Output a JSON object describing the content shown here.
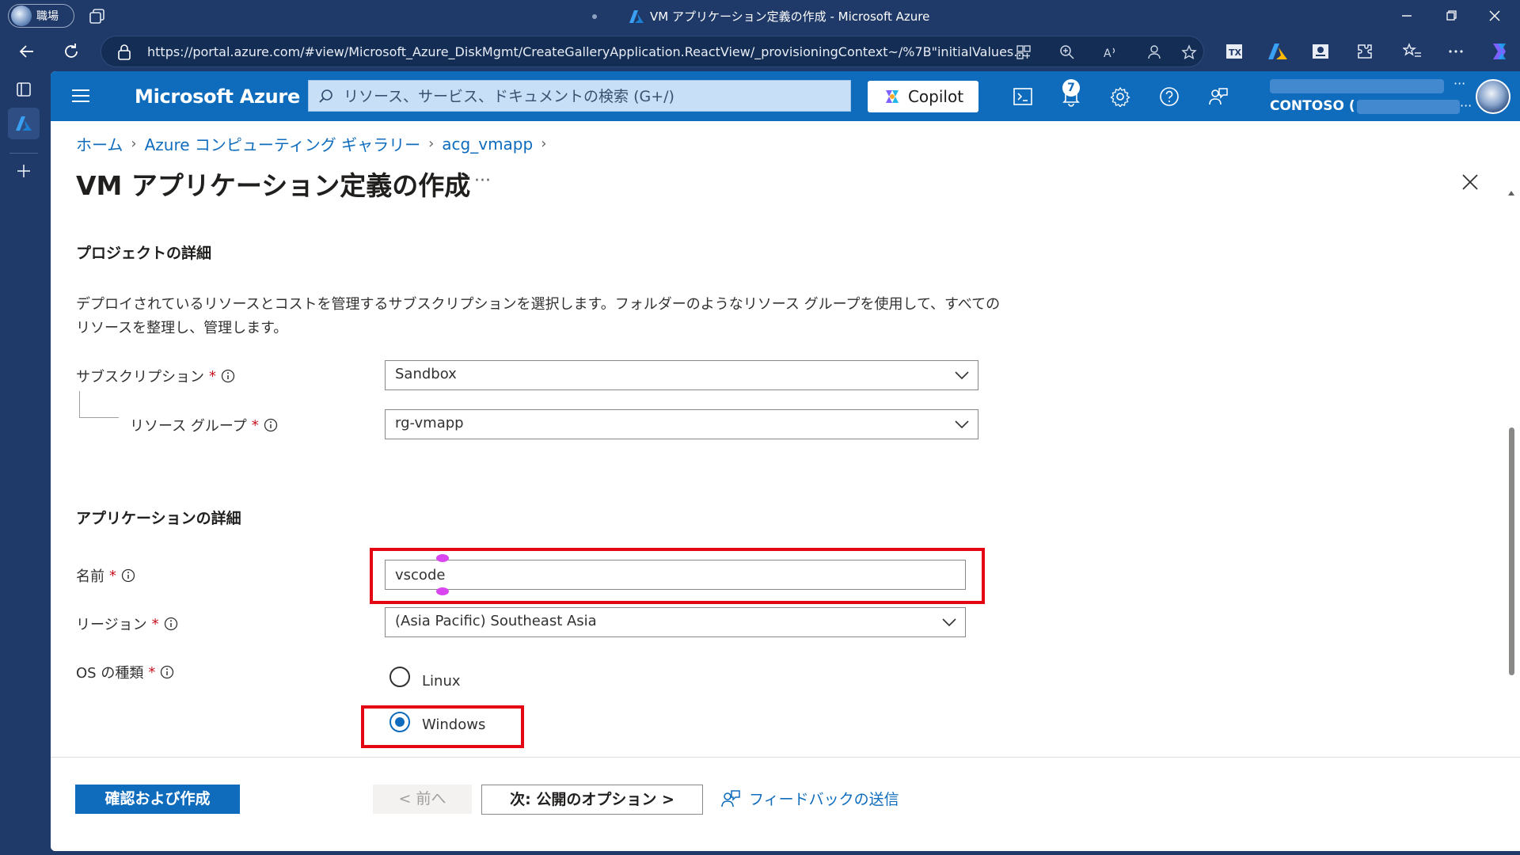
{
  "browser": {
    "profile_label": "職場",
    "window_title": "VM アプリケーション定義の作成 - Microsoft Azure",
    "url": "https://portal.azure.com/#view/Microsoft_Azure_DiskMgmt/CreateGalleryApplication.ReactView/_provisioningContext~/%7B\"initialValues..."
  },
  "portal": {
    "brand": "Microsoft Azure",
    "search_placeholder": "リソース、サービス、ドキュメントの検索 (G+/)",
    "copilot_label": "Copilot",
    "notification_count": "7",
    "tenant_label": "CONTOSO (",
    "accent_color": "#0f6cbd"
  },
  "breadcrumb": {
    "items": [
      "ホーム",
      "Azure コンピューティング ギャラリー",
      "acg_vmapp"
    ]
  },
  "page": {
    "title": "VM アプリケーション定義の作成",
    "more_label": "···"
  },
  "project": {
    "section_title": "プロジェクトの詳細",
    "description": "デプロイされているリソースとコストを管理するサブスクリプションを選択します。フォルダーのようなリソース グループを使用して、すべてのリソースを整理し、管理します。",
    "subscription_label": "サブスクリプション",
    "subscription_value": "Sandbox",
    "resource_group_label": "リソース グループ",
    "resource_group_value": "rg-vmapp"
  },
  "application": {
    "section_title": "アプリケーションの詳細",
    "name_label": "名前",
    "name_value": "vscode",
    "region_label": "リージョン",
    "region_value": "(Asia Pacific) Southeast Asia",
    "os_label": "OS の種類",
    "os_options": [
      "Linux",
      "Windows"
    ],
    "os_selected": "Windows"
  },
  "required_mark": "*",
  "footer": {
    "review_create": "確認および作成",
    "previous": "< 前へ",
    "next": "次: 公開のオプション >",
    "feedback": "フィードバックの送信"
  }
}
